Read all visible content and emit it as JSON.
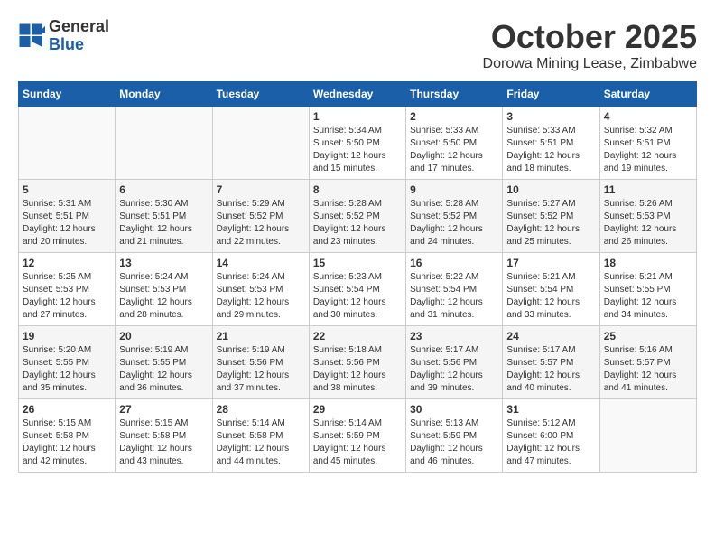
{
  "header": {
    "logo_general": "General",
    "logo_blue": "Blue",
    "month": "October 2025",
    "location": "Dorowa Mining Lease, Zimbabwe"
  },
  "weekdays": [
    "Sunday",
    "Monday",
    "Tuesday",
    "Wednesday",
    "Thursday",
    "Friday",
    "Saturday"
  ],
  "weeks": [
    [
      {
        "day": "",
        "sunrise": "",
        "sunset": "",
        "daylight": ""
      },
      {
        "day": "",
        "sunrise": "",
        "sunset": "",
        "daylight": ""
      },
      {
        "day": "",
        "sunrise": "",
        "sunset": "",
        "daylight": ""
      },
      {
        "day": "1",
        "sunrise": "Sunrise: 5:34 AM",
        "sunset": "Sunset: 5:50 PM",
        "daylight": "Daylight: 12 hours and 15 minutes."
      },
      {
        "day": "2",
        "sunrise": "Sunrise: 5:33 AM",
        "sunset": "Sunset: 5:50 PM",
        "daylight": "Daylight: 12 hours and 17 minutes."
      },
      {
        "day": "3",
        "sunrise": "Sunrise: 5:33 AM",
        "sunset": "Sunset: 5:51 PM",
        "daylight": "Daylight: 12 hours and 18 minutes."
      },
      {
        "day": "4",
        "sunrise": "Sunrise: 5:32 AM",
        "sunset": "Sunset: 5:51 PM",
        "daylight": "Daylight: 12 hours and 19 minutes."
      }
    ],
    [
      {
        "day": "5",
        "sunrise": "Sunrise: 5:31 AM",
        "sunset": "Sunset: 5:51 PM",
        "daylight": "Daylight: 12 hours and 20 minutes."
      },
      {
        "day": "6",
        "sunrise": "Sunrise: 5:30 AM",
        "sunset": "Sunset: 5:51 PM",
        "daylight": "Daylight: 12 hours and 21 minutes."
      },
      {
        "day": "7",
        "sunrise": "Sunrise: 5:29 AM",
        "sunset": "Sunset: 5:52 PM",
        "daylight": "Daylight: 12 hours and 22 minutes."
      },
      {
        "day": "8",
        "sunrise": "Sunrise: 5:28 AM",
        "sunset": "Sunset: 5:52 PM",
        "daylight": "Daylight: 12 hours and 23 minutes."
      },
      {
        "day": "9",
        "sunrise": "Sunrise: 5:28 AM",
        "sunset": "Sunset: 5:52 PM",
        "daylight": "Daylight: 12 hours and 24 minutes."
      },
      {
        "day": "10",
        "sunrise": "Sunrise: 5:27 AM",
        "sunset": "Sunset: 5:52 PM",
        "daylight": "Daylight: 12 hours and 25 minutes."
      },
      {
        "day": "11",
        "sunrise": "Sunrise: 5:26 AM",
        "sunset": "Sunset: 5:53 PM",
        "daylight": "Daylight: 12 hours and 26 minutes."
      }
    ],
    [
      {
        "day": "12",
        "sunrise": "Sunrise: 5:25 AM",
        "sunset": "Sunset: 5:53 PM",
        "daylight": "Daylight: 12 hours and 27 minutes."
      },
      {
        "day": "13",
        "sunrise": "Sunrise: 5:24 AM",
        "sunset": "Sunset: 5:53 PM",
        "daylight": "Daylight: 12 hours and 28 minutes."
      },
      {
        "day": "14",
        "sunrise": "Sunrise: 5:24 AM",
        "sunset": "Sunset: 5:53 PM",
        "daylight": "Daylight: 12 hours and 29 minutes."
      },
      {
        "day": "15",
        "sunrise": "Sunrise: 5:23 AM",
        "sunset": "Sunset: 5:54 PM",
        "daylight": "Daylight: 12 hours and 30 minutes."
      },
      {
        "day": "16",
        "sunrise": "Sunrise: 5:22 AM",
        "sunset": "Sunset: 5:54 PM",
        "daylight": "Daylight: 12 hours and 31 minutes."
      },
      {
        "day": "17",
        "sunrise": "Sunrise: 5:21 AM",
        "sunset": "Sunset: 5:54 PM",
        "daylight": "Daylight: 12 hours and 33 minutes."
      },
      {
        "day": "18",
        "sunrise": "Sunrise: 5:21 AM",
        "sunset": "Sunset: 5:55 PM",
        "daylight": "Daylight: 12 hours and 34 minutes."
      }
    ],
    [
      {
        "day": "19",
        "sunrise": "Sunrise: 5:20 AM",
        "sunset": "Sunset: 5:55 PM",
        "daylight": "Daylight: 12 hours and 35 minutes."
      },
      {
        "day": "20",
        "sunrise": "Sunrise: 5:19 AM",
        "sunset": "Sunset: 5:55 PM",
        "daylight": "Daylight: 12 hours and 36 minutes."
      },
      {
        "day": "21",
        "sunrise": "Sunrise: 5:19 AM",
        "sunset": "Sunset: 5:56 PM",
        "daylight": "Daylight: 12 hours and 37 minutes."
      },
      {
        "day": "22",
        "sunrise": "Sunrise: 5:18 AM",
        "sunset": "Sunset: 5:56 PM",
        "daylight": "Daylight: 12 hours and 38 minutes."
      },
      {
        "day": "23",
        "sunrise": "Sunrise: 5:17 AM",
        "sunset": "Sunset: 5:56 PM",
        "daylight": "Daylight: 12 hours and 39 minutes."
      },
      {
        "day": "24",
        "sunrise": "Sunrise: 5:17 AM",
        "sunset": "Sunset: 5:57 PM",
        "daylight": "Daylight: 12 hours and 40 minutes."
      },
      {
        "day": "25",
        "sunrise": "Sunrise: 5:16 AM",
        "sunset": "Sunset: 5:57 PM",
        "daylight": "Daylight: 12 hours and 41 minutes."
      }
    ],
    [
      {
        "day": "26",
        "sunrise": "Sunrise: 5:15 AM",
        "sunset": "Sunset: 5:58 PM",
        "daylight": "Daylight: 12 hours and 42 minutes."
      },
      {
        "day": "27",
        "sunrise": "Sunrise: 5:15 AM",
        "sunset": "Sunset: 5:58 PM",
        "daylight": "Daylight: 12 hours and 43 minutes."
      },
      {
        "day": "28",
        "sunrise": "Sunrise: 5:14 AM",
        "sunset": "Sunset: 5:58 PM",
        "daylight": "Daylight: 12 hours and 44 minutes."
      },
      {
        "day": "29",
        "sunrise": "Sunrise: 5:14 AM",
        "sunset": "Sunset: 5:59 PM",
        "daylight": "Daylight: 12 hours and 45 minutes."
      },
      {
        "day": "30",
        "sunrise": "Sunrise: 5:13 AM",
        "sunset": "Sunset: 5:59 PM",
        "daylight": "Daylight: 12 hours and 46 minutes."
      },
      {
        "day": "31",
        "sunrise": "Sunrise: 5:12 AM",
        "sunset": "Sunset: 6:00 PM",
        "daylight": "Daylight: 12 hours and 47 minutes."
      },
      {
        "day": "",
        "sunrise": "",
        "sunset": "",
        "daylight": ""
      }
    ]
  ]
}
